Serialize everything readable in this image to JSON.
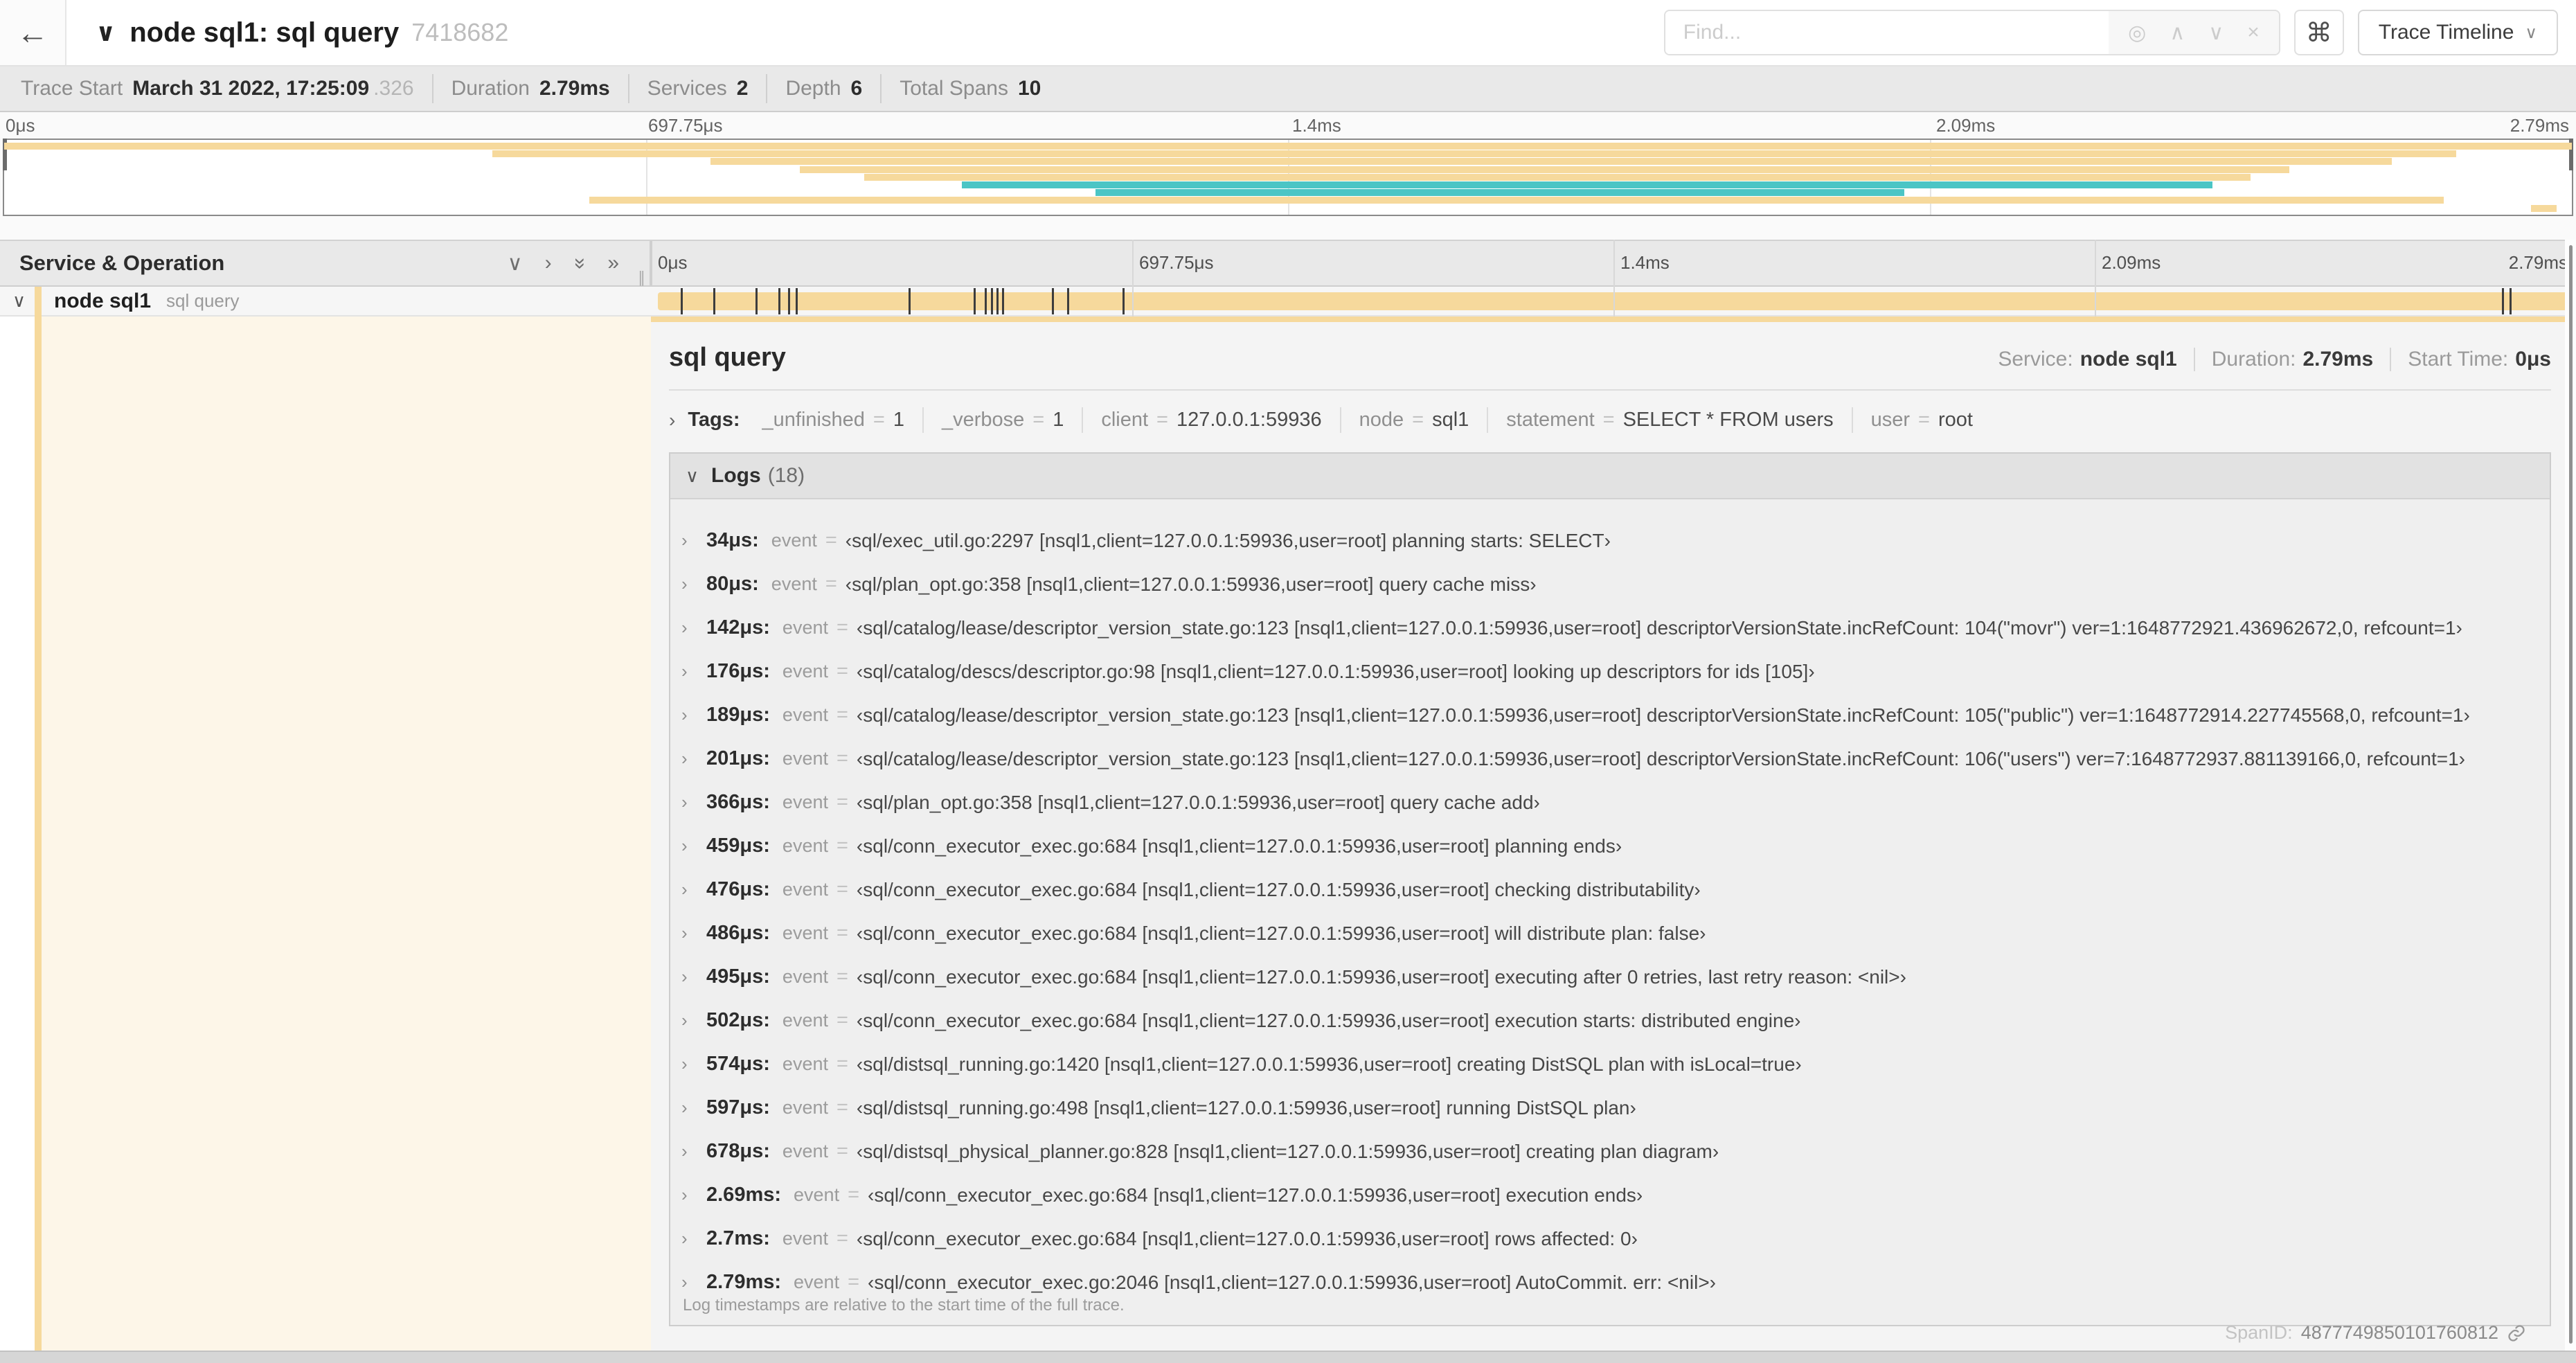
{
  "icons": {
    "back": "←",
    "chevron_down": "∨",
    "chevron_up": "∧",
    "chevron_right": "›",
    "double_chevron_right": "»",
    "close": "×",
    "target": "◎",
    "command": "⌘",
    "grip": "∥"
  },
  "colors": {
    "span_tan": "#F6D99C",
    "span_teal": "#4BC5C5",
    "detail_cream": "#FDF6E8"
  },
  "header": {
    "title": "node sql1: sql query",
    "trace_id": "7418682",
    "find_placeholder": "Find...",
    "view_selector": "Trace Timeline"
  },
  "trace_info": {
    "items": [
      {
        "label": "Trace Start",
        "value": "March 31 2022, 17:25:09",
        "value_muted": ".326"
      },
      {
        "label": "Duration",
        "value": "2.79ms"
      },
      {
        "label": "Services",
        "value": "2"
      },
      {
        "label": "Depth",
        "value": "6"
      },
      {
        "label": "Total Spans",
        "value": "10"
      }
    ]
  },
  "minimap": {
    "axis_ticks": [
      "0μs",
      "697.75μs",
      "1.4ms",
      "2.09ms",
      "2.79ms"
    ],
    "spans": [
      {
        "row": 0,
        "start": 0,
        "end": 100,
        "color": "tan"
      },
      {
        "row": 1,
        "start": 19,
        "end": 95.5,
        "color": "tan"
      },
      {
        "row": 2,
        "start": 27.5,
        "end": 93,
        "color": "tan"
      },
      {
        "row": 3,
        "start": 31,
        "end": 89,
        "color": "tan"
      },
      {
        "row": 4,
        "start": 33.5,
        "end": 87.5,
        "color": "tan"
      },
      {
        "row": 5,
        "start": 37.3,
        "end": 86,
        "color": "teal"
      },
      {
        "row": 6,
        "start": 42.5,
        "end": 74,
        "color": "teal"
      },
      {
        "row": 7,
        "start": 22.8,
        "end": 95,
        "color": "tan"
      },
      {
        "row": 8,
        "start": 98.4,
        "end": 99.4,
        "color": "tan"
      }
    ]
  },
  "timeline": {
    "left_header": "Service & Operation",
    "ticks": [
      "0μs",
      "697.75μs",
      "1.4ms",
      "2.09ms",
      "2.79ms"
    ],
    "span_row": {
      "service": "node sql1",
      "operation": "sql query",
      "log_ticks_pct": [
        1.2,
        2.9,
        5.1,
        6.3,
        6.8,
        7.2,
        13.1,
        16.5,
        17.1,
        17.4,
        17.7,
        18.0,
        20.6,
        21.4,
        24.3,
        96.4,
        96.8,
        99.8
      ]
    }
  },
  "detail": {
    "title": "sql query",
    "info": [
      {
        "label": "Service:",
        "value": "node sql1"
      },
      {
        "label": "Duration:",
        "value": "2.79ms"
      },
      {
        "label": "Start Time:",
        "value": "0μs"
      }
    ],
    "tags": {
      "label": "Tags:",
      "items": [
        {
          "key": "_unfinished",
          "value": "1"
        },
        {
          "key": "_verbose",
          "value": "1"
        },
        {
          "key": "client",
          "value": "127.0.0.1:59936"
        },
        {
          "key": "node",
          "value": "sql1"
        },
        {
          "key": "statement",
          "value": "SELECT * FROM users"
        },
        {
          "key": "user",
          "value": "root"
        }
      ]
    },
    "logs": {
      "label": "Logs",
      "count": "(18)",
      "rows": [
        {
          "time": "34μs:",
          "key": "event",
          "value": "‹sql/exec_util.go:2297 [nsql1,client=127.0.0.1:59936,user=root] planning starts: SELECT›"
        },
        {
          "time": "80μs:",
          "key": "event",
          "value": "‹sql/plan_opt.go:358 [nsql1,client=127.0.0.1:59936,user=root] query cache miss›"
        },
        {
          "time": "142μs:",
          "key": "event",
          "value": "‹sql/catalog/lease/descriptor_version_state.go:123 [nsql1,client=127.0.0.1:59936,user=root] descriptorVersionState.incRefCount: 104(\"movr\") ver=1:1648772921.436962672,0, refcount=1›"
        },
        {
          "time": "176μs:",
          "key": "event",
          "value": "‹sql/catalog/descs/descriptor.go:98 [nsql1,client=127.0.0.1:59936,user=root] looking up descriptors for ids [105]›"
        },
        {
          "time": "189μs:",
          "key": "event",
          "value": "‹sql/catalog/lease/descriptor_version_state.go:123 [nsql1,client=127.0.0.1:59936,user=root] descriptorVersionState.incRefCount: 105(\"public\") ver=1:1648772914.227745568,0, refcount=1›"
        },
        {
          "time": "201μs:",
          "key": "event",
          "value": "‹sql/catalog/lease/descriptor_version_state.go:123 [nsql1,client=127.0.0.1:59936,user=root] descriptorVersionState.incRefCount: 106(\"users\") ver=7:1648772937.881139166,0, refcount=1›"
        },
        {
          "time": "366μs:",
          "key": "event",
          "value": "‹sql/plan_opt.go:358 [nsql1,client=127.0.0.1:59936,user=root] query cache add›"
        },
        {
          "time": "459μs:",
          "key": "event",
          "value": "‹sql/conn_executor_exec.go:684 [nsql1,client=127.0.0.1:59936,user=root] planning ends›"
        },
        {
          "time": "476μs:",
          "key": "event",
          "value": "‹sql/conn_executor_exec.go:684 [nsql1,client=127.0.0.1:59936,user=root] checking distributability›"
        },
        {
          "time": "486μs:",
          "key": "event",
          "value": "‹sql/conn_executor_exec.go:684 [nsql1,client=127.0.0.1:59936,user=root] will distribute plan: false›"
        },
        {
          "time": "495μs:",
          "key": "event",
          "value": "‹sql/conn_executor_exec.go:684 [nsql1,client=127.0.0.1:59936,user=root] executing after 0 retries, last retry reason: <nil>›"
        },
        {
          "time": "502μs:",
          "key": "event",
          "value": "‹sql/conn_executor_exec.go:684 [nsql1,client=127.0.0.1:59936,user=root] execution starts: distributed engine›"
        },
        {
          "time": "574μs:",
          "key": "event",
          "value": "‹sql/distsql_running.go:1420 [nsql1,client=127.0.0.1:59936,user=root] creating DistSQL plan with isLocal=true›"
        },
        {
          "time": "597μs:",
          "key": "event",
          "value": "‹sql/distsql_running.go:498 [nsql1,client=127.0.0.1:59936,user=root] running DistSQL plan›"
        },
        {
          "time": "678μs:",
          "key": "event",
          "value": "‹sql/distsql_physical_planner.go:828 [nsql1,client=127.0.0.1:59936,user=root] creating plan diagram›"
        },
        {
          "time": "2.69ms:",
          "key": "event",
          "value": "‹sql/conn_executor_exec.go:684 [nsql1,client=127.0.0.1:59936,user=root] execution ends›"
        },
        {
          "time": "2.7ms:",
          "key": "event",
          "value": "‹sql/conn_executor_exec.go:684 [nsql1,client=127.0.0.1:59936,user=root] rows affected: 0›"
        },
        {
          "time": "2.79ms:",
          "key": "event",
          "value": "‹sql/conn_executor_exec.go:2046 [nsql1,client=127.0.0.1:59936,user=root] AutoCommit. err: <nil>›"
        }
      ],
      "footnote": "Log timestamps are relative to the start time of the full trace."
    },
    "span_id_label": "SpanID:",
    "span_id": "4877749850101760812"
  }
}
